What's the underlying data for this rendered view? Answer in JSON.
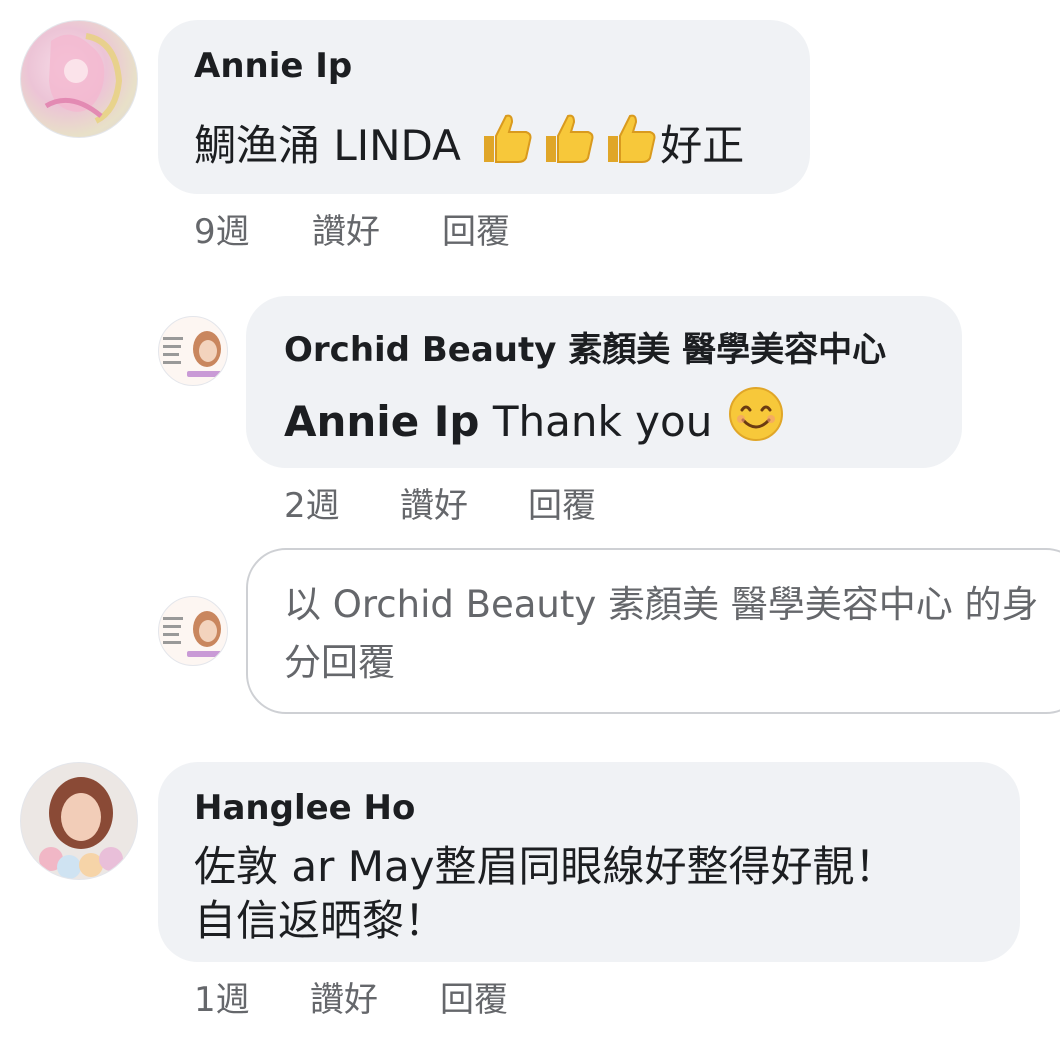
{
  "comments": [
    {
      "author": "Annie Ip",
      "text_before": "鯛渔涌 LINDA",
      "emojis": [
        "thumbs-up-icon",
        "thumbs-up-icon",
        "thumbs-up-icon"
      ],
      "text_after": "好正",
      "time": "9週",
      "like_label": "讚好",
      "reply_label": "回覆"
    },
    {
      "author": "Orchid Beauty 素顏美 醫學美容中心",
      "mention": "Annie Ip",
      "text": " Thank you ",
      "emoji": "smiling-face-icon",
      "time": "2週",
      "like_label": "讚好",
      "reply_label": "回覆"
    },
    {
      "author": "Hanglee Ho",
      "text_line1": "佐敦 ar May整眉同眼線好整得好靚！",
      "text_line2": "自信返晒黎！",
      "time": "1週",
      "like_label": "讚好",
      "reply_label": "回覆"
    }
  ],
  "reply_box": {
    "placeholder": "以 Orchid Beauty 素顏美 醫學美容中心 的身分回覆"
  },
  "colors": {
    "bubble": "#f0f2f5",
    "secondary_text": "#65676b",
    "emoji_yellow": "#f7c83a"
  }
}
